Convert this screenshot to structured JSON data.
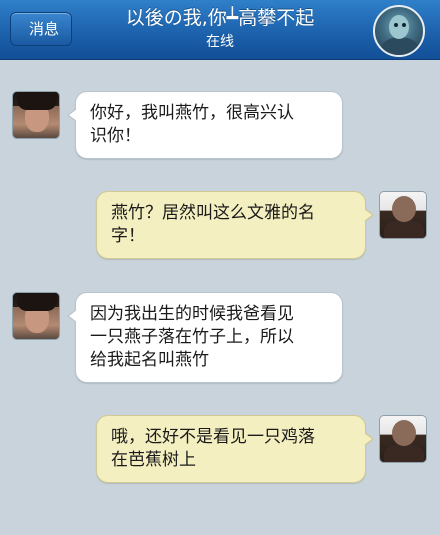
{
  "header": {
    "back_label": "消息",
    "title": "以後の我,你┷高攀不起",
    "status": "在线"
  },
  "colors": {
    "header_blue": "#1d62ad",
    "background": "#c9d3dc",
    "incoming_bubble": "#ffffff",
    "outgoing_bubble": "#f4efc0"
  },
  "messages": [
    {
      "sender": "contact",
      "lines": [
        "你好，我叫燕竹，很高兴认",
        "识你！"
      ]
    },
    {
      "sender": "me",
      "lines": [
        "燕竹？居然叫这么文雅的名",
        "字！"
      ]
    },
    {
      "sender": "contact",
      "lines": [
        "因为我出生的时候我爸看见",
        "一只燕子落在竹子上，所以",
        "给我起名叫燕竹"
      ]
    },
    {
      "sender": "me",
      "lines": [
        "哦，还好不是看见一只鸡落",
        "在芭蕉树上"
      ]
    }
  ]
}
